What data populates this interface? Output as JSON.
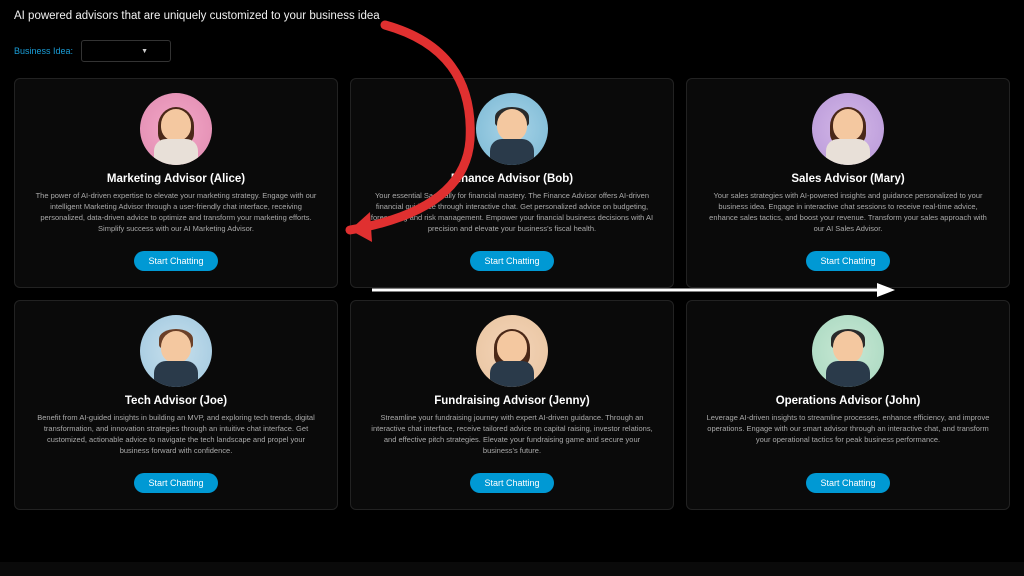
{
  "heading": "AI powered advisors that are uniquely customized to your business idea",
  "filter": {
    "label": "Business Idea:",
    "value": ""
  },
  "button_label": "Start Chatting",
  "advisors": [
    {
      "title": "Marketing Advisor (Alice)",
      "description": "The power of AI-driven expertise to elevate your marketing strategy. Engage with our intelligent Marketing Advisor through a user-friendly chat interface, receiving personalized, data-driven advice to optimize and transform your marketing efforts. Simplify success with our AI Marketing Advisor.",
      "avatar_bg": "avatar-bg-pink"
    },
    {
      "title": "Finance Advisor (Bob)",
      "description": "Your essential SaaS ally for financial mastery. The Finance Advisor offers AI-driven financial guidance through interactive chat. Get personalized advice on budgeting, forecasting and risk management. Empower your financial business decisions with AI precision and elevate your business's fiscal health.",
      "avatar_bg": "avatar-bg-blue"
    },
    {
      "title": "Sales Advisor (Mary)",
      "description": "Your sales strategies with AI-powered insights and guidance personalized to your business idea. Engage in interactive chat sessions to receive real-time advice, enhance sales tactics, and boost your revenue. Transform your sales approach with our AI Sales Advisor.",
      "avatar_bg": "avatar-bg-purple"
    },
    {
      "title": "Tech Advisor (Joe)",
      "description": "Benefit from AI-guided insights in building an MVP, and exploring tech trends, digital transformation, and innovation strategies through an intuitive chat interface. Get customized, actionable advice to navigate the tech landscape and propel your business forward with confidence.",
      "avatar_bg": "avatar-bg-lightblue"
    },
    {
      "title": "Fundraising Advisor (Jenny)",
      "description": "Streamline your fundraising journey with expert AI-driven guidance. Through an interactive chat interface, receive tailored advice on capital raising, investor relations, and effective pitch strategies. Elevate your fundraising game and secure your business's future.",
      "avatar_bg": "avatar-bg-peach"
    },
    {
      "title": "Operations Advisor (John)",
      "description": "Leverage AI-driven insights to streamline processes, enhance efficiency, and improve operations. Engage with our smart advisor through an interactive chat, and transform your operational tactics for peak business performance.",
      "avatar_bg": "avatar-bg-mint"
    }
  ]
}
